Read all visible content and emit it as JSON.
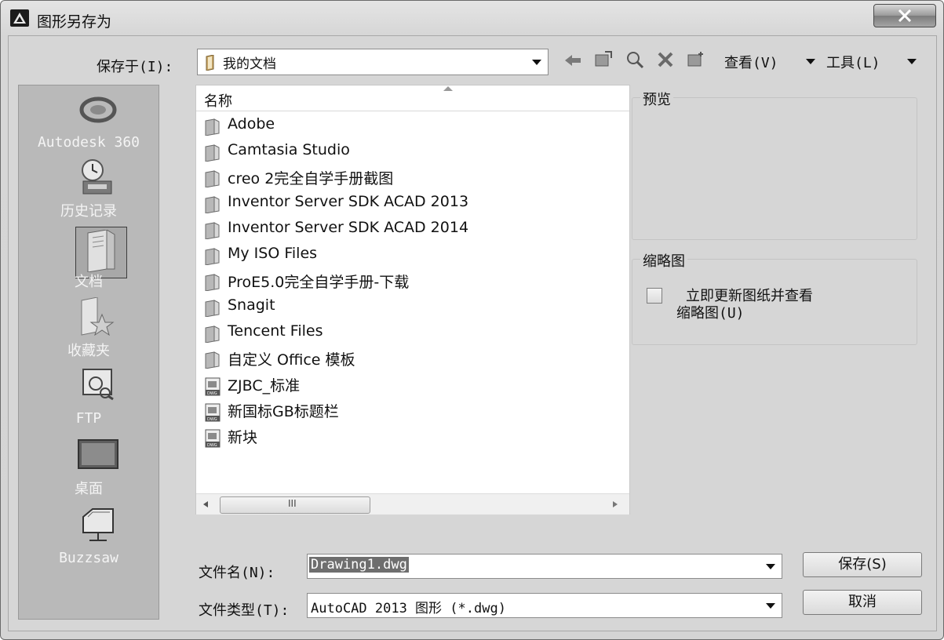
{
  "window": {
    "title": "图形另存为"
  },
  "toolbar": {
    "save_in_label": "保存于(I):",
    "location": "我的文档",
    "view_menu": "查看(V)",
    "tools_menu": "工具(L)"
  },
  "sidebar": {
    "items": [
      {
        "label": "Autodesk 360",
        "icon": "autodesk-360-icon"
      },
      {
        "label": "历史记录",
        "icon": "history-icon"
      },
      {
        "label": "文档",
        "icon": "documents-icon"
      },
      {
        "label": "收藏夹",
        "icon": "favorites-icon"
      },
      {
        "label": "FTP",
        "icon": "ftp-icon"
      },
      {
        "label": "桌面",
        "icon": "desktop-icon"
      },
      {
        "label": "Buzzsaw",
        "icon": "buzzsaw-icon"
      }
    ]
  },
  "filelist": {
    "column_name": "名称",
    "items": [
      {
        "name": "Adobe",
        "type": "folder"
      },
      {
        "name": "Camtasia Studio",
        "type": "folder"
      },
      {
        "name": "creo 2完全自学手册截图",
        "type": "folder"
      },
      {
        "name": "Inventor Server SDK ACAD 2013",
        "type": "folder"
      },
      {
        "name": "Inventor Server SDK ACAD 2014",
        "type": "folder"
      },
      {
        "name": "My ISO Files",
        "type": "folder"
      },
      {
        "name": "ProE5.0完全自学手册-下载",
        "type": "folder"
      },
      {
        "name": "Snagit",
        "type": "folder"
      },
      {
        "name": "Tencent Files",
        "type": "folder"
      },
      {
        "name": "自定义 Office 模板",
        "type": "folder"
      },
      {
        "name": "ZJBC_标准",
        "type": "dwg"
      },
      {
        "name": "新国标GB标题栏",
        "type": "dwg"
      },
      {
        "name": "新块",
        "type": "dwg"
      }
    ],
    "scroll_grip": "III"
  },
  "preview": {
    "title": "预览"
  },
  "thumbnail": {
    "title": "缩略图",
    "checkbox_line1": "立即更新图纸并查看",
    "checkbox_line2": "缩略图(U)"
  },
  "footer": {
    "filename_label": "文件名(N):",
    "filename_value": "Drawing1.dwg",
    "filetype_label": "文件类型(T):",
    "filetype_value": "AutoCAD 2013 图形 (*.dwg)",
    "save_button": "保存(S)",
    "cancel_button": "取消"
  }
}
